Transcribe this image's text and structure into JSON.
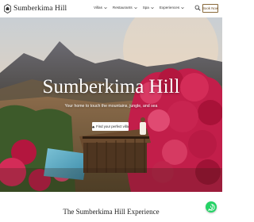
{
  "header": {
    "logo_text": "Sumberkima Hill",
    "nav": [
      {
        "label": "Villas",
        "icon": "chevron-down-icon"
      },
      {
        "label": "Restaurants",
        "icon": "chevron-down-icon"
      },
      {
        "label": "Spa",
        "icon": "chevron-down-icon"
      },
      {
        "label": "Experiences",
        "icon": "chevron-down-icon"
      }
    ],
    "search_icon": "search-icon",
    "book_label": "Book Now",
    "accent": "#8a6a3a"
  },
  "hero": {
    "title": "Sumberkima Hill",
    "subtitle": "Your home to touch the mountains, jungle, and sea",
    "cta_label": "Find your perfect villa",
    "cta_icon": "home-icon"
  },
  "section": {
    "title": "The Sumberkima Hill Experience"
  },
  "floating": {
    "icon": "whatsapp-icon",
    "color": "#25d366"
  }
}
